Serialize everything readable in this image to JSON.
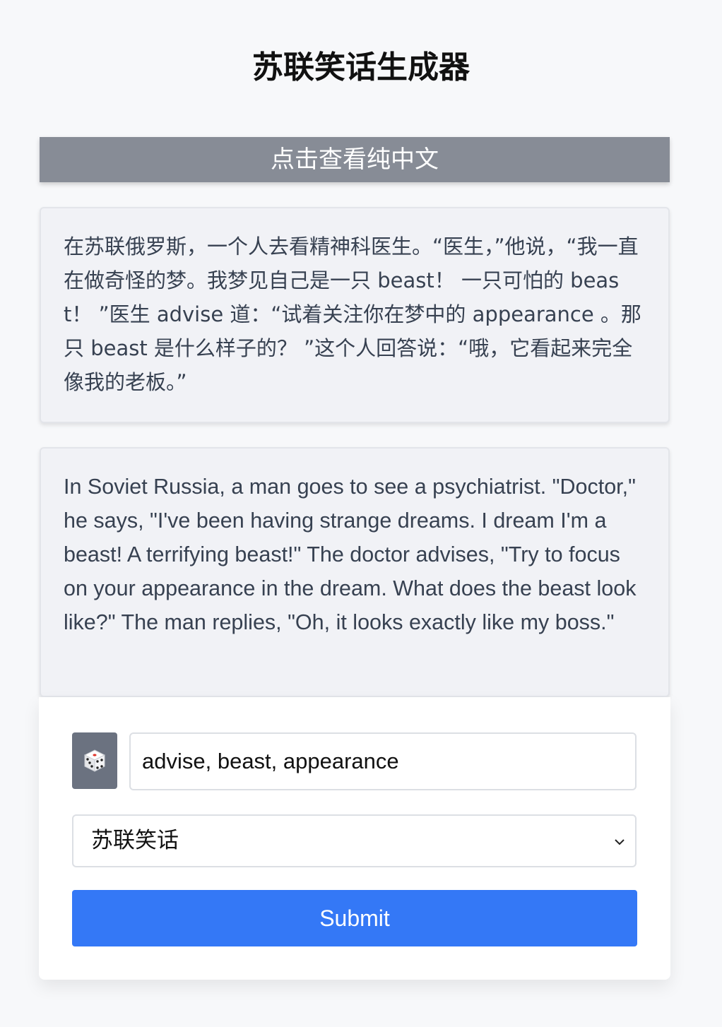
{
  "header": {
    "title": "苏联笑话生成器"
  },
  "toggle": {
    "label": "点击查看纯中文"
  },
  "jokes": {
    "chinese": "在苏联俄罗斯，一个人去看精神科医生。“医生，”他说，“我一直在做奇怪的梦。我梦见自己是一只 beast！ 一只可怕的 beast！ ”医生 advise 道：“试着关注你在梦中的 appearance 。那只 beast 是什么样子的？ ”这个人回答说：“哦，它看起来完全像我的老板。”",
    "english": "In Soviet Russia, a man goes to see a psychiatrist. \"Doctor,\" he says, \"I've been having strange dreams. I dream I'm a beast! A terrifying beast!\" The doctor advises, \"Try to focus on your appearance in the dream. What does the beast look like?\" The man replies, \"Oh, it looks exactly like my boss.\""
  },
  "form": {
    "dice_icon": "dice-icon",
    "keywords_value": "advise, beast, appearance",
    "joke_type_selected": "苏联笑话",
    "submit_label": "Submit"
  },
  "colors": {
    "background": "#f7f8fa",
    "toggle_bg": "#878c96",
    "card_bg": "#f1f2f6",
    "dice_bg": "#6b7280",
    "submit_bg": "#3478f6"
  }
}
